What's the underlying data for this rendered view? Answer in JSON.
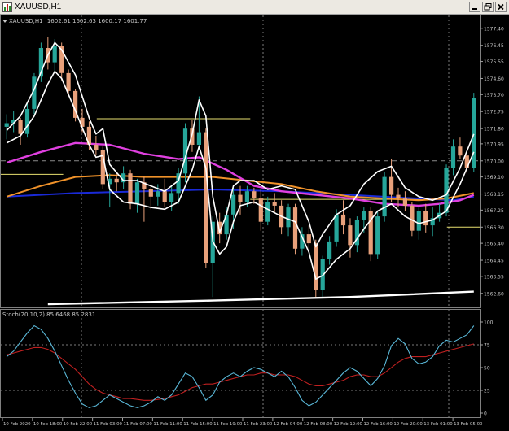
{
  "window": {
    "title": "XAUUSD,H1",
    "minimize_icon": "minimize-icon",
    "restore_icon": "restore-icon",
    "close_icon": "close-icon"
  },
  "colors": {
    "background": "#000000",
    "bull_candle": "#26a69a",
    "bear_candle": "#e8a07a",
    "ma_magenta": "#e040e0",
    "ma_orange": "#f0922a",
    "ma_blue": "#1a2ad8",
    "envelope_white": "#ffffff",
    "level_yellow": "#e8e070",
    "stoch_main": "#5ab8d8",
    "stoch_signal": "#c02020",
    "grid": "#7a7a7a",
    "text": "#c8c8c8"
  },
  "price_panel": {
    "label": "XAUUSD,H1",
    "ohlc": "1602.61 1602.63 1600.17 1601.77"
  },
  "stoch_panel": {
    "label": "Stoch(20,10,2) 85.6468 85.2831"
  },
  "chart_data": [
    {
      "type": "candlestick",
      "symbol": "XAUUSD",
      "timeframe": "H1",
      "y_ticks": [
        "1577.40",
        "1576.45",
        "1575.55",
        "1574.60",
        "1573.70",
        "1572.75",
        "1571.80",
        "1570.95",
        "1570.00",
        "1569.10",
        "1568.15",
        "1567.25",
        "1566.30",
        "1565.40",
        "1564.45",
        "1563.55",
        "1562.60"
      ],
      "ylim": [
        1562.0,
        1577.8
      ],
      "x_ticks": [
        "10 Feb 2020",
        "10 Feb 18:00",
        "10 Feb 22:00",
        "11 Feb 03:00",
        "11 Feb 07:00",
        "11 Feb 11:00",
        "11 Feb 15:00",
        "11 Feb 19:00",
        "11 Feb 23:00",
        "12 Feb 04:00",
        "12 Feb 08:00",
        "12 Feb 12:00",
        "12 Feb 16:00",
        "12 Feb 20:00",
        "13 Feb 01:00",
        "13 Feb 05:00"
      ],
      "candles": [
        [
          1571.9,
          1572.6,
          1571.2,
          1572.1
        ],
        [
          1572.1,
          1572.8,
          1571.6,
          1572.3
        ],
        [
          1572.3,
          1572.4,
          1570.9,
          1571.5
        ],
        [
          1571.5,
          1573.2,
          1571.3,
          1572.9
        ],
        [
          1572.9,
          1574.9,
          1572.6,
          1574.7
        ],
        [
          1574.7,
          1576.6,
          1574.4,
          1576.3
        ],
        [
          1576.3,
          1576.9,
          1575.1,
          1575.5
        ],
        [
          1575.5,
          1576.8,
          1575.0,
          1576.4
        ],
        [
          1576.4,
          1576.6,
          1574.5,
          1574.9
        ],
        [
          1574.9,
          1575.1,
          1573.6,
          1573.9
        ],
        [
          1573.9,
          1574.0,
          1572.2,
          1572.4
        ],
        [
          1572.4,
          1572.9,
          1571.6,
          1571.9
        ],
        [
          1571.9,
          1572.2,
          1570.6,
          1570.9
        ],
        [
          1570.9,
          1571.4,
          1570.3,
          1570.6
        ],
        [
          1570.6,
          1570.8,
          1568.4,
          1568.7
        ],
        [
          1568.7,
          1569.3,
          1567.4,
          1569.0
        ],
        [
          1569.0,
          1569.4,
          1568.3,
          1568.8
        ],
        [
          1568.8,
          1569.7,
          1568.4,
          1569.3
        ],
        [
          1569.3,
          1569.5,
          1567.3,
          1567.6
        ],
        [
          1567.6,
          1569.0,
          1567.1,
          1568.8
        ],
        [
          1568.8,
          1569.1,
          1566.6,
          1568.4
        ],
        [
          1568.4,
          1568.6,
          1567.3,
          1568.0
        ],
        [
          1568.0,
          1568.7,
          1567.5,
          1568.3
        ],
        [
          1568.3,
          1569.0,
          1567.4,
          1567.7
        ],
        [
          1567.7,
          1568.6,
          1567.2,
          1568.2
        ],
        [
          1568.2,
          1569.6,
          1567.6,
          1569.3
        ],
        [
          1569.3,
          1572.1,
          1568.8,
          1571.8
        ],
        [
          1571.8,
          1572.3,
          1570.5,
          1570.9
        ],
        [
          1570.9,
          1573.6,
          1570.6,
          1571.6
        ],
        [
          1571.6,
          1571.8,
          1564.0,
          1564.3
        ],
        [
          1564.3,
          1566.9,
          1562.4,
          1566.6
        ],
        [
          1566.6,
          1567.1,
          1565.4,
          1565.9
        ],
        [
          1565.9,
          1567.4,
          1565.6,
          1567.0
        ],
        [
          1567.0,
          1568.5,
          1566.2,
          1568.1
        ],
        [
          1568.1,
          1568.6,
          1567.0,
          1567.7
        ],
        [
          1567.7,
          1568.6,
          1567.4,
          1568.3
        ],
        [
          1568.3,
          1568.5,
          1567.6,
          1567.9
        ],
        [
          1567.9,
          1568.4,
          1566.1,
          1566.6
        ],
        [
          1566.6,
          1568.0,
          1566.4,
          1567.7
        ],
        [
          1567.7,
          1568.2,
          1567.1,
          1567.5
        ],
        [
          1567.5,
          1567.8,
          1565.9,
          1566.3
        ],
        [
          1566.3,
          1567.6,
          1565.8,
          1567.4
        ],
        [
          1567.4,
          1567.6,
          1564.8,
          1565.1
        ],
        [
          1565.1,
          1566.3,
          1564.7,
          1565.9
        ],
        [
          1565.9,
          1566.4,
          1565.1,
          1565.4
        ],
        [
          1565.4,
          1565.6,
          1562.4,
          1562.8
        ],
        [
          1562.8,
          1564.7,
          1562.4,
          1564.5
        ],
        [
          1564.5,
          1565.8,
          1564.2,
          1565.5
        ],
        [
          1565.5,
          1567.3,
          1565.2,
          1567.0
        ],
        [
          1567.0,
          1567.8,
          1565.9,
          1566.4
        ],
        [
          1566.4,
          1566.8,
          1564.6,
          1565.3
        ],
        [
          1565.3,
          1566.9,
          1564.9,
          1566.7
        ],
        [
          1566.7,
          1567.4,
          1566.0,
          1567.2
        ],
        [
          1567.2,
          1567.4,
          1564.4,
          1564.8
        ],
        [
          1564.8,
          1567.2,
          1564.5,
          1566.9
        ],
        [
          1566.9,
          1569.4,
          1566.6,
          1569.1
        ],
        [
          1569.1,
          1570.1,
          1567.7,
          1568.1
        ],
        [
          1568.1,
          1568.5,
          1567.4,
          1567.9
        ],
        [
          1567.9,
          1568.3,
          1567.2,
          1567.5
        ],
        [
          1567.5,
          1567.7,
          1565.8,
          1566.1
        ],
        [
          1566.1,
          1567.4,
          1565.6,
          1567.2
        ],
        [
          1567.2,
          1567.6,
          1566.0,
          1566.4
        ],
        [
          1566.4,
          1567.4,
          1565.8,
          1566.8
        ],
        [
          1566.8,
          1567.6,
          1566.6,
          1567.1
        ],
        [
          1567.1,
          1569.8,
          1566.9,
          1569.6
        ],
        [
          1569.6,
          1571.2,
          1569.2,
          1570.8
        ],
        [
          1570.8,
          1571.3,
          1570.1,
          1570.3
        ],
        [
          1570.3,
          1570.5,
          1569.3,
          1569.6
        ],
        [
          1569.6,
          1573.8,
          1569.4,
          1573.5
        ]
      ],
      "horizontal_lines": [
        {
          "value": 1572.35,
          "from": 0.2,
          "to": 0.52,
          "color": "#e8e070"
        },
        {
          "value": 1569.25,
          "from": 0.0,
          "to": 0.13,
          "color": "#e8e070"
        },
        {
          "value": 1570.0,
          "from": 0.0,
          "to": 1.0,
          "color": "#8a8a8a",
          "style": "dashed"
        },
        {
          "value": 1567.85,
          "from": 0.52,
          "to": 0.93,
          "color": "#e8e070"
        },
        {
          "value": 1566.3,
          "from": 0.93,
          "to": 1.0,
          "color": "#e8e070"
        }
      ],
      "ma_magenta": [
        [
          0,
          1569.9
        ],
        [
          5,
          1570.5
        ],
        [
          10,
          1571.0
        ],
        [
          15,
          1570.9
        ],
        [
          20,
          1570.4
        ],
        [
          25,
          1570.1
        ],
        [
          28,
          1570.2
        ],
        [
          32,
          1569.5
        ],
        [
          36,
          1568.6
        ],
        [
          40,
          1568.3
        ],
        [
          45,
          1568.1
        ],
        [
          50,
          1567.9
        ],
        [
          55,
          1567.6
        ],
        [
          60,
          1567.5
        ],
        [
          63,
          1567.6
        ],
        [
          66,
          1567.8
        ],
        [
          68,
          1568.1
        ]
      ],
      "ma_orange": [
        [
          0,
          1568.0
        ],
        [
          5,
          1568.6
        ],
        [
          10,
          1569.1
        ],
        [
          15,
          1569.2
        ],
        [
          20,
          1569.1
        ],
        [
          25,
          1569.1
        ],
        [
          30,
          1569.1
        ],
        [
          35,
          1568.9
        ],
        [
          40,
          1568.7
        ],
        [
          45,
          1568.3
        ],
        [
          50,
          1568.0
        ],
        [
          55,
          1567.9
        ],
        [
          60,
          1567.8
        ],
        [
          64,
          1567.9
        ],
        [
          68,
          1568.2
        ]
      ],
      "ma_blue": [
        [
          0,
          1568.0
        ],
        [
          10,
          1568.2
        ],
        [
          20,
          1568.3
        ],
        [
          30,
          1568.4
        ],
        [
          40,
          1568.3
        ],
        [
          50,
          1568.1
        ],
        [
          60,
          1567.9
        ],
        [
          65,
          1567.8
        ],
        [
          68,
          1568.0
        ]
      ],
      "envelope_upper": [
        [
          0,
          1571.7
        ],
        [
          2,
          1572.5
        ],
        [
          4,
          1574.0
        ],
        [
          6,
          1575.9
        ],
        [
          7,
          1576.6
        ],
        [
          8,
          1576.2
        ],
        [
          10,
          1574.8
        ],
        [
          12,
          1572.4
        ],
        [
          13,
          1571.5
        ],
        [
          14,
          1571.8
        ],
        [
          15,
          1569.8
        ],
        [
          17,
          1568.9
        ],
        [
          19,
          1568.9
        ],
        [
          21,
          1568.6
        ],
        [
          23,
          1568.3
        ],
        [
          25,
          1568.9
        ],
        [
          27,
          1571.5
        ],
        [
          28,
          1573.4
        ],
        [
          29,
          1572.5
        ],
        [
          30,
          1568.0
        ],
        [
          31,
          1566.0
        ],
        [
          32,
          1567.0
        ],
        [
          33,
          1568.6
        ],
        [
          34,
          1568.9
        ],
        [
          36,
          1568.9
        ],
        [
          38,
          1568.4
        ],
        [
          40,
          1568.6
        ],
        [
          42,
          1568.4
        ],
        [
          44,
          1566.6
        ],
        [
          45,
          1565.2
        ],
        [
          46,
          1565.9
        ],
        [
          48,
          1567.0
        ],
        [
          50,
          1567.5
        ],
        [
          52,
          1568.7
        ],
        [
          54,
          1569.4
        ],
        [
          56,
          1569.7
        ],
        [
          58,
          1568.5
        ],
        [
          60,
          1568.0
        ],
        [
          62,
          1567.8
        ],
        [
          64,
          1568.1
        ],
        [
          66,
          1569.6
        ],
        [
          68,
          1571.5
        ]
      ],
      "envelope_lower": [
        [
          0,
          1571.0
        ],
        [
          2,
          1571.4
        ],
        [
          4,
          1572.5
        ],
        [
          6,
          1574.3
        ],
        [
          7,
          1575.0
        ],
        [
          8,
          1574.6
        ],
        [
          10,
          1572.8
        ],
        [
          12,
          1570.9
        ],
        [
          13,
          1570.2
        ],
        [
          14,
          1570.3
        ],
        [
          15,
          1568.4
        ],
        [
          17,
          1567.7
        ],
        [
          19,
          1567.6
        ],
        [
          21,
          1567.4
        ],
        [
          23,
          1567.3
        ],
        [
          25,
          1567.7
        ],
        [
          27,
          1569.5
        ],
        [
          28,
          1570.8
        ],
        [
          29,
          1569.6
        ],
        [
          30,
          1565.5
        ],
        [
          31,
          1564.8
        ],
        [
          32,
          1565.2
        ],
        [
          33,
          1566.6
        ],
        [
          34,
          1567.5
        ],
        [
          36,
          1567.7
        ],
        [
          38,
          1567.3
        ],
        [
          40,
          1566.9
        ],
        [
          42,
          1566.6
        ],
        [
          44,
          1564.9
        ],
        [
          45,
          1563.4
        ],
        [
          46,
          1563.6
        ],
        [
          48,
          1564.5
        ],
        [
          50,
          1565.1
        ],
        [
          52,
          1566.2
        ],
        [
          54,
          1567.2
        ],
        [
          56,
          1567.6
        ],
        [
          58,
          1566.9
        ],
        [
          60,
          1566.5
        ],
        [
          62,
          1566.7
        ],
        [
          64,
          1567.2
        ],
        [
          66,
          1568.7
        ],
        [
          68,
          1570.5
        ]
      ],
      "support_line": [
        [
          6,
          1562.0
        ],
        [
          30,
          1562.2
        ],
        [
          50,
          1562.4
        ],
        [
          68,
          1562.7
        ]
      ]
    },
    {
      "type": "line",
      "title": "Stoch(20,10,2) 85.6468 85.2831",
      "ylim": [
        0,
        100
      ],
      "y_ticks": [
        "100",
        "75",
        "50",
        "25",
        "0"
      ],
      "series": [
        {
          "values": [
            62,
            68,
            78,
            88,
            96,
            92,
            82,
            68,
            52,
            36,
            22,
            10,
            6,
            8,
            14,
            20,
            16,
            12,
            8,
            6,
            8,
            12,
            18,
            14,
            20,
            32,
            44,
            40,
            28,
            14,
            20,
            34,
            40,
            44,
            40,
            46,
            50,
            48,
            44,
            40,
            46,
            40,
            28,
            14,
            8,
            12,
            20,
            28,
            36,
            44,
            50,
            46,
            38,
            30,
            38,
            52,
            74,
            82,
            76,
            60,
            54,
            56,
            62,
            74,
            80,
            78,
            82,
            86,
            96
          ]
        },
        {
          "values": [
            64,
            66,
            68,
            70,
            72,
            72,
            70,
            66,
            60,
            54,
            48,
            40,
            32,
            26,
            22,
            20,
            18,
            16,
            16,
            15,
            14,
            14,
            15,
            16,
            18,
            20,
            24,
            28,
            30,
            32,
            32,
            34,
            36,
            38,
            40,
            42,
            42,
            44,
            44,
            42,
            42,
            42,
            40,
            36,
            32,
            30,
            30,
            32,
            34,
            36,
            40,
            42,
            42,
            40,
            40,
            44,
            50,
            56,
            60,
            62,
            62,
            62,
            64,
            66,
            68,
            70,
            72,
            74,
            76
          ]
        }
      ]
    }
  ]
}
